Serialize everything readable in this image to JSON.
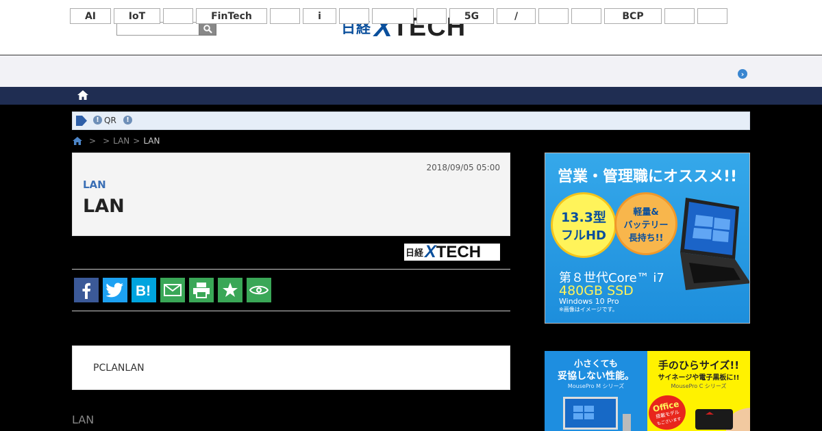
{
  "header": {
    "search_placeholder": "",
    "logo": {
      "prefix": "日経",
      "x": "X",
      "tech": "TECH"
    }
  },
  "category_nav": {
    "items": [
      "AI",
      "IoT",
      "",
      "FinTech",
      "",
      "i",
      "",
      "",
      "",
      "5G",
      "/",
      "",
      "",
      "BCP",
      "",
      ""
    ]
  },
  "notice": {
    "qr_label": "QR"
  },
  "breadcrumb": {
    "sep1": ">",
    "sep2": ">",
    "item1": "LAN",
    "sep3": ">",
    "current": "LAN"
  },
  "article": {
    "date": "2018/09/05 05:00",
    "category": "LAN",
    "title": "LAN",
    "source_logo": {
      "prefix": "日経",
      "x": "X",
      "tech": "TECH"
    },
    "summary": "PCLANLAN",
    "body_start": "LAN"
  },
  "share": {
    "buttons": [
      {
        "icon": "facebook-icon",
        "color": "#3b5998"
      },
      {
        "icon": "twitter-icon",
        "color": "#1da1f2"
      },
      {
        "icon": "hatena-bookmark-icon",
        "color": "#00a4de"
      },
      {
        "icon": "mail-icon",
        "color": "#3aa757"
      },
      {
        "icon": "print-icon",
        "color": "#3aa757"
      },
      {
        "icon": "star-icon",
        "color": "#3aa757"
      },
      {
        "icon": "eye-icon",
        "color": "#3aa757"
      }
    ]
  },
  "ads": {
    "ad1": {
      "headline": "営業・管理職にオススメ!!",
      "badge1_line1": "13.3型",
      "badge1_line2": "フルHD",
      "badge2_line1": "軽量&",
      "badge2_line2": "バッテリー",
      "badge2_line3": "長持ち!!",
      "cpu": "第８世代Core™ i7",
      "storage": "480GB SSD",
      "os": "Windows 10 Pro",
      "note": "※画像はイメージです。"
    },
    "ad2": {
      "left_line1": "小さくても",
      "left_line2": "妥協しない性能。",
      "left_series": "MousePro M シリーズ",
      "right_line1": "手のひらサイズ!!",
      "right_line2": "サイネージや電子黒板に!!",
      "right_series": "MousePro C シリーズ",
      "office_line1": "Office",
      "office_line2": "搭載モデル",
      "office_line3": "もございます"
    }
  },
  "colors": {
    "brand_blue": "#0a4f9c",
    "nav_bar": "#1f2d52",
    "share_green": "#3aa757"
  }
}
